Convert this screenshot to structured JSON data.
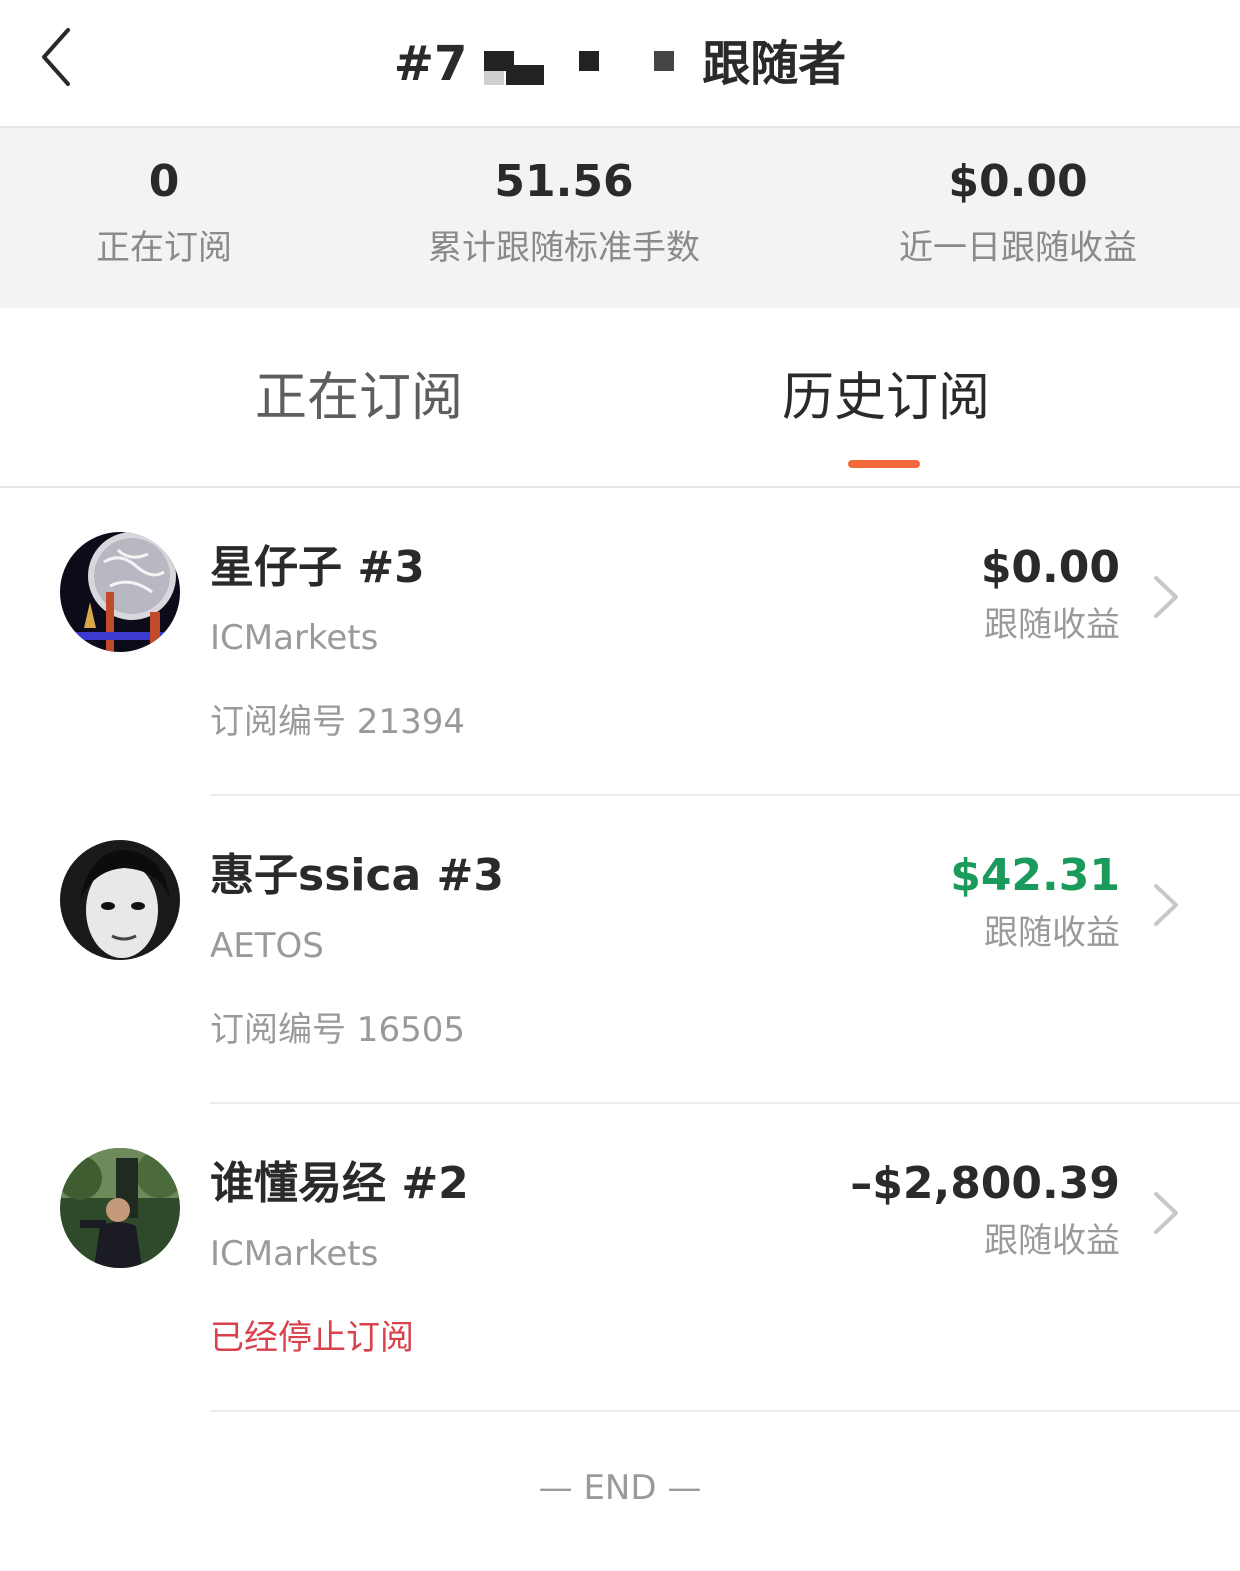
{
  "header": {
    "back_icon": "chevron-left-icon",
    "title_prefix": "#7",
    "title_suffix": "跟随者"
  },
  "stats": [
    {
      "value": "0",
      "label": "正在订阅"
    },
    {
      "value": "51.56",
      "label": "累计跟随标准手数"
    },
    {
      "value": "$0.00",
      "label": "近一日跟随收益"
    }
  ],
  "tabs": {
    "current": "正在订阅",
    "history": "历史订阅",
    "active": "history",
    "accent_color": "#f2693a"
  },
  "subscriptions": [
    {
      "name": "星仔子 #3",
      "broker": "ICMarkets",
      "status_text": "订阅编号 21394",
      "amount": "$0.00",
      "amount_label": "跟随收益",
      "amount_color": "#2a2a2a",
      "status_color": "#9a9a9a"
    },
    {
      "name": "惠子ssica #3",
      "broker": "AETOS",
      "status_text": "订阅编号 16505",
      "amount": "$42.31",
      "amount_label": "跟随收益",
      "amount_color": "#1a9a5b",
      "status_color": "#9a9a9a"
    },
    {
      "name": "谁懂易经 #2",
      "broker": "ICMarkets",
      "status_text": "已经停止订阅",
      "amount": "–$2,800.39",
      "amount_label": "跟随收益",
      "amount_color": "#2a2a2a",
      "status_color": "#d9414d"
    }
  ],
  "footer": {
    "end_text": "— END —"
  }
}
